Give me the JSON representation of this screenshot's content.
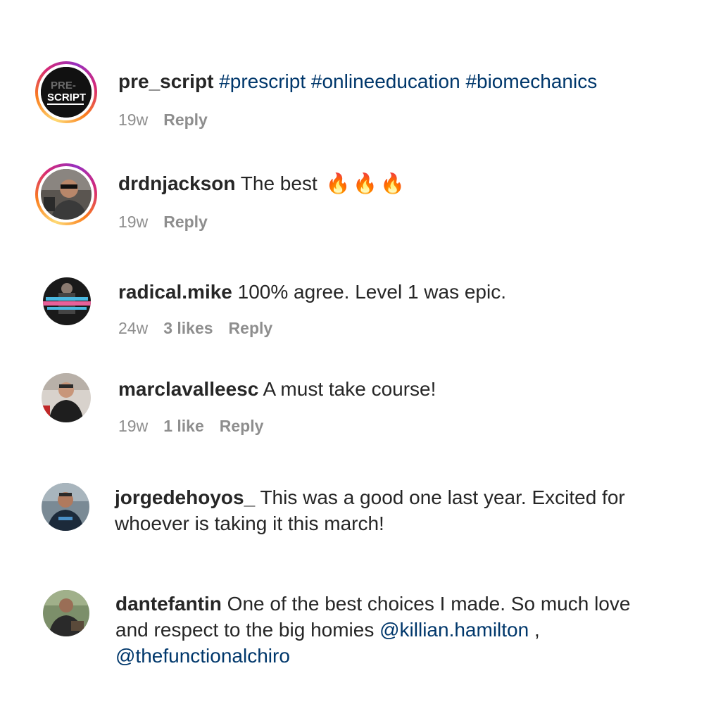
{
  "comments": [
    {
      "username": "pre_script",
      "body_tags": [
        "#prescript",
        "#onlineeducation",
        "#biomechanics"
      ],
      "time": "19w",
      "reply": "Reply",
      "avatar": {
        "type": "logo",
        "text_top": "PRE-",
        "text_bottom": "SCRIPT",
        "has_story_ring": true
      }
    },
    {
      "username": "drdnjackson",
      "body": "The best",
      "emoji": [
        "🔥",
        "🔥",
        "🔥"
      ],
      "time": "19w",
      "reply": "Reply",
      "avatar": {
        "type": "photo",
        "has_story_ring": true
      }
    },
    {
      "username": "radical.mike",
      "body": "100% agree. Level 1 was epic.",
      "time": "24w",
      "likes": "3 likes",
      "reply": "Reply",
      "avatar": {
        "type": "photo",
        "has_story_ring": false
      }
    },
    {
      "username": "marclavalleesc",
      "body": "A must take course!",
      "time": "19w",
      "likes": "1 like",
      "reply": "Reply",
      "avatar": {
        "type": "photo",
        "has_story_ring": false
      }
    },
    {
      "username": "jorgedehoyos_",
      "body_line1": "This was a good one last year. Excited for",
      "body_line2": "whoever is taking it this march!",
      "avatar": {
        "type": "photo",
        "has_story_ring": false
      }
    },
    {
      "username": "dantefantin",
      "body_line1": "One of the best choices I made. So much love",
      "body_line2_text": "and respect to the big homies",
      "mention1": "@killian.hamilton",
      "separator": ",",
      "mention2": "@thefunctionalchiro",
      "avatar": {
        "type": "photo",
        "has_story_ring": false
      }
    }
  ],
  "colors": {
    "text": "#262626",
    "muted": "#8e8e8e",
    "link": "#00376b"
  }
}
